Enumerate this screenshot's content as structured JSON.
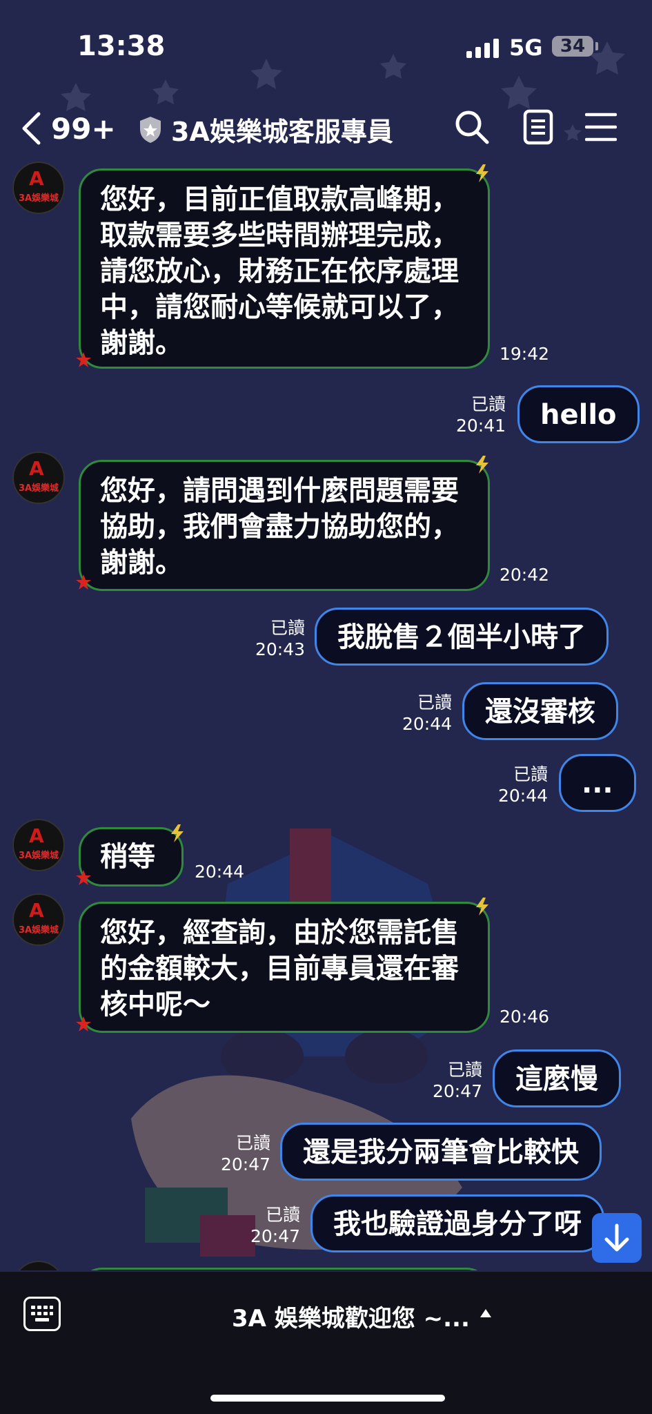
{
  "status": {
    "time": "13:38",
    "network": "5G",
    "battery": "34"
  },
  "header": {
    "back_count": "99+",
    "title": "3A娛樂城客服專員"
  },
  "avatar_text": "3A娛樂城",
  "messages": [
    {
      "side": "in",
      "text": "您好，目前正值取款高峰期，取款需要多些時間辦理完成，請您放心，財務正在依序處理中，請您耐心等候就可以了，謝謝。",
      "time": "19:42"
    },
    {
      "side": "out",
      "text": "hello",
      "read": "已讀",
      "time": "20:41"
    },
    {
      "side": "in",
      "text": "您好，請問遇到什麼問題需要協助，我們會盡力協助您的，謝謝。",
      "time": "20:42"
    },
    {
      "side": "out",
      "text": "我脫售２個半小時了",
      "read": "已讀",
      "time": "20:43"
    },
    {
      "side": "out",
      "text": "還沒審核",
      "read": "已讀",
      "time": "20:44"
    },
    {
      "side": "out",
      "text": "...",
      "read": "已讀",
      "time": "20:44"
    },
    {
      "side": "in",
      "text": "稍等",
      "time": "20:44"
    },
    {
      "side": "in",
      "text": "您好，經查詢，由於您需託售的金額較大，目前專員還在審核中呢～",
      "time": "20:46"
    },
    {
      "side": "out",
      "text": "這麼慢",
      "read": "已讀",
      "time": "20:47"
    },
    {
      "side": "out",
      "text": "還是我分兩筆會比較快",
      "read": "已讀",
      "time": "20:47"
    },
    {
      "side": "out",
      "text": "我也驗證過身分了呀",
      "read": "已讀",
      "time": "20:47"
    }
  ],
  "bottom": {
    "menu_label": "3A 娛樂城歡迎您 ~..."
  },
  "colors": {
    "background": "#23264d",
    "incoming_border": "#2f8a3e",
    "outgoing_border": "#3f86e8",
    "accent": "#2f6de8"
  }
}
